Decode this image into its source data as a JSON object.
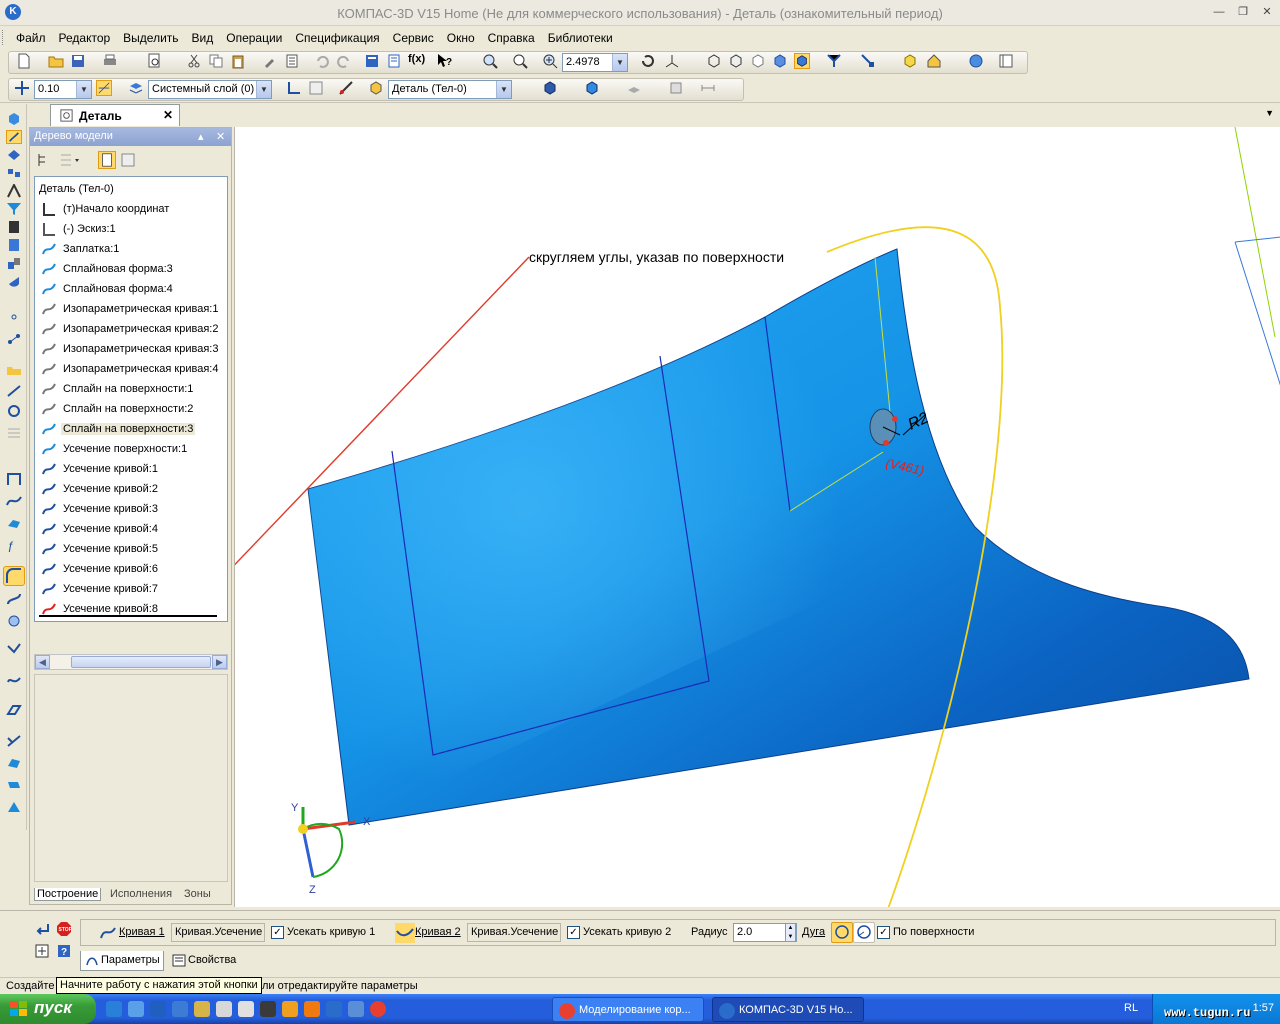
{
  "window": {
    "title": "КОМПАС-3D V15 Home (Не для коммерческого использования) - Деталь (ознакомительный период)",
    "app_icon_letter": "K"
  },
  "menu": [
    "Файл",
    "Редактор",
    "Выделить",
    "Вид",
    "Операции",
    "Спецификация",
    "Сервис",
    "Окно",
    "Справка",
    "Библиотеки"
  ],
  "toolbar": {
    "zoom_value": "2.4978",
    "step_value": "0.10",
    "layer_value": "Системный слой (0)",
    "body_value": "Деталь (Тел-0)"
  },
  "document_tab": {
    "label": "Деталь"
  },
  "model_tree": {
    "title": "Дерево модели",
    "root": "Деталь (Тел-0)",
    "selected_index": 12,
    "items": [
      "(т)Начало координат",
      "(-) Эскиз:1",
      "Заплатка:1",
      "Сплайновая форма:3",
      "Сплайновая форма:4",
      "Изопараметрическая кривая:1",
      "Изопараметрическая кривая:2",
      "Изопараметрическая кривая:3",
      "Изопараметрическая кривая:4",
      "Сплайн на поверхности:1",
      "Сплайн на поверхности:2",
      "Сплайн на поверхности:3",
      "Усечение поверхности:1",
      "Усечение кривой:1",
      "Усечение кривой:2",
      "Усечение кривой:3",
      "Усечение кривой:4",
      "Усечение кривой:5",
      "Усечение кривой:6",
      "Усечение кривой:7",
      "Усечение кривой:8"
    ],
    "bottom_tabs": [
      "Построение",
      "Исполнения",
      "Зоны"
    ]
  },
  "viewport": {
    "annotation": "скругляем углы, указав по поверхности",
    "dim_radius": "R2",
    "dim_marker": "(V461)",
    "axis_x": "X",
    "axis_y": "Y",
    "axis_z": "Z",
    "surface_color": "#1a8fe0",
    "arrow_red": "#e03a2a",
    "arrow_yellow": "#f0d020"
  },
  "property_bar": {
    "curve1_label": "Кривая 1",
    "curve1_value": "Кривая.Усечение",
    "trim1_label": "Усекать кривую 1",
    "curve2_label": "Кривая 2",
    "curve2_value": "Кривая.Усечение",
    "trim2_label": "Усекать кривую 2",
    "radius_label": "Радиус",
    "radius_value": "2.0",
    "arc_label": "Дуга",
    "by_surface_label": "По поверхности",
    "tabs": [
      "Параметры",
      "Свойства"
    ]
  },
  "status": {
    "left": "Создайте",
    "tooltip": "Начните работу с нажатия этой кнопки",
    "right": "ли отредактируйте параметры"
  },
  "taskbar": {
    "start": "пуск",
    "task1": "Моделирование кор...",
    "task2": "КОМПАС-3D V15 Ho...",
    "lang": "RL",
    "clock": "1:57",
    "watermark": "www.tugun.ru"
  }
}
